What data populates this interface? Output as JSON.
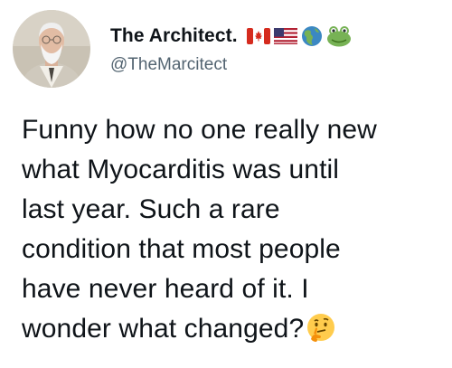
{
  "author": {
    "display_name": "The Architect.",
    "handle": "@TheMarcitect",
    "name_emojis": [
      "canada-flag-icon",
      "usa-flag-icon",
      "globe-americas-icon",
      "frog-face-icon"
    ]
  },
  "tweet": {
    "lines": [
      "Funny how no one really new",
      "what Myocarditis was until",
      "last year. Such a rare",
      "condition that most people",
      "have never heard of it. I",
      "wonder what changed?"
    ],
    "trailing_emoji": "thinking-face-icon"
  },
  "colors": {
    "text": "#0f1419",
    "secondary_text": "#536471",
    "background": "#ffffff"
  }
}
